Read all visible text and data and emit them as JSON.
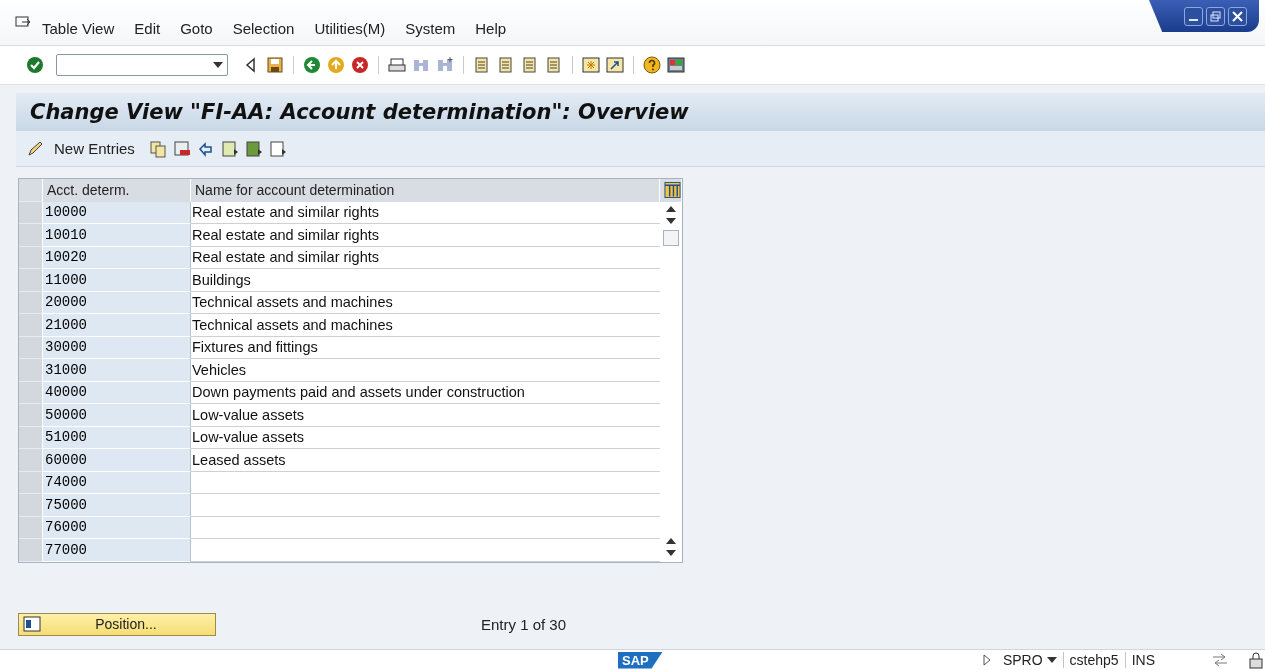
{
  "menu": [
    "Table View",
    "Edit",
    "Goto",
    "Selection",
    "Utilities(M)",
    "System",
    "Help"
  ],
  "title": "Change View \"FI-AA: Account determination\": Overview",
  "app_toolbar": {
    "new_entries": "New Entries"
  },
  "table": {
    "columns": [
      "Acct. determ.",
      "Name for account determination"
    ],
    "rows": [
      [
        "10000",
        "Real estate and similar rights"
      ],
      [
        "10010",
        "Real estate and similar rights"
      ],
      [
        "10020",
        "Real estate and similar rights"
      ],
      [
        "11000",
        "Buildings"
      ],
      [
        "20000",
        "Technical assets and machines"
      ],
      [
        "21000",
        "Technical assets and machines"
      ],
      [
        "30000",
        "Fixtures and fittings"
      ],
      [
        "31000",
        "Vehicles"
      ],
      [
        "40000",
        "Down payments paid and assets under construction"
      ],
      [
        "50000",
        "Low-value assets"
      ],
      [
        "51000",
        "Low-value assets"
      ],
      [
        "60000",
        "Leased assets"
      ],
      [
        "74000",
        ""
      ],
      [
        "75000",
        ""
      ],
      [
        "76000",
        ""
      ],
      [
        "77000",
        ""
      ]
    ]
  },
  "position_button": "Position...",
  "entry_info": "Entry 1 of 30",
  "status_bar": {
    "logo": "SAP",
    "transaction": "SPRO",
    "server": "cstehp5",
    "mode": "INS"
  }
}
